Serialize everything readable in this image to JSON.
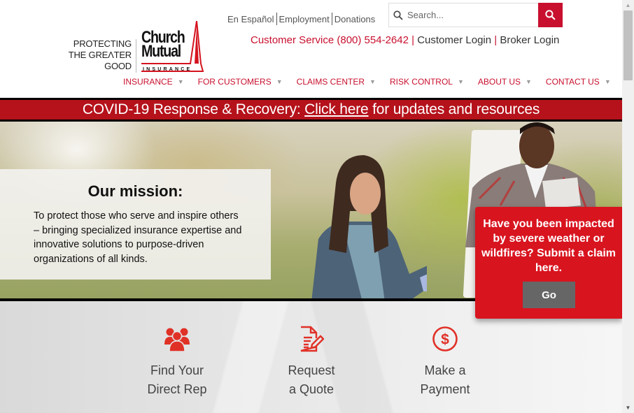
{
  "header": {
    "util_links": [
      "En Español",
      "Employment",
      "Donations"
    ],
    "search": {
      "placeholder": "Search...",
      "button_icon": "search-icon"
    },
    "customer_service": "Customer Service (800) 554-2642",
    "separator": "|",
    "customer_login": "Customer Login",
    "broker_login": "Broker Login",
    "logo": {
      "tagline_lines": [
        "PROTECTING",
        "THE GREΛTER",
        "GOOD"
      ],
      "brand_lines": [
        "Church",
        "Mutual"
      ],
      "sub": "INSURANCE"
    },
    "nav": [
      {
        "label": "INSURANCE"
      },
      {
        "label": "FOR CUSTOMERS"
      },
      {
        "label": "CLAIMS CENTER"
      },
      {
        "label": "RISK CONTROL"
      },
      {
        "label": "ABOUT US"
      },
      {
        "label": "CONTACT US"
      }
    ],
    "nav_caret": "▼"
  },
  "covid_banner": {
    "prefix": "COVID-19 Response & Recovery: ",
    "link": "Click here",
    "suffix": " for updates and resources"
  },
  "hero": {
    "mission_title": "Our mission:",
    "mission_text": "To protect those who serve and inspire others – bringing specialized insurance expertise and innovative solutions to purpose-driven organizations of all kinds."
  },
  "claim_card": {
    "text": "Have you been impacted by severe weather or wildfires? Submit a claim here.",
    "button": "Go"
  },
  "quick_links": [
    {
      "icon": "users-icon",
      "line1": "Find Your",
      "line2": "Direct Rep"
    },
    {
      "icon": "document-edit-icon",
      "line1": "Request",
      "line2": "a Quote"
    },
    {
      "icon": "dollar-circle-icon",
      "line1": "Make a",
      "line2": "Payment"
    }
  ],
  "colors": {
    "brand_red": "#c8102e",
    "banner_red": "#b5121b",
    "claim_red": "#d8141f",
    "go_gray": "#666666"
  }
}
